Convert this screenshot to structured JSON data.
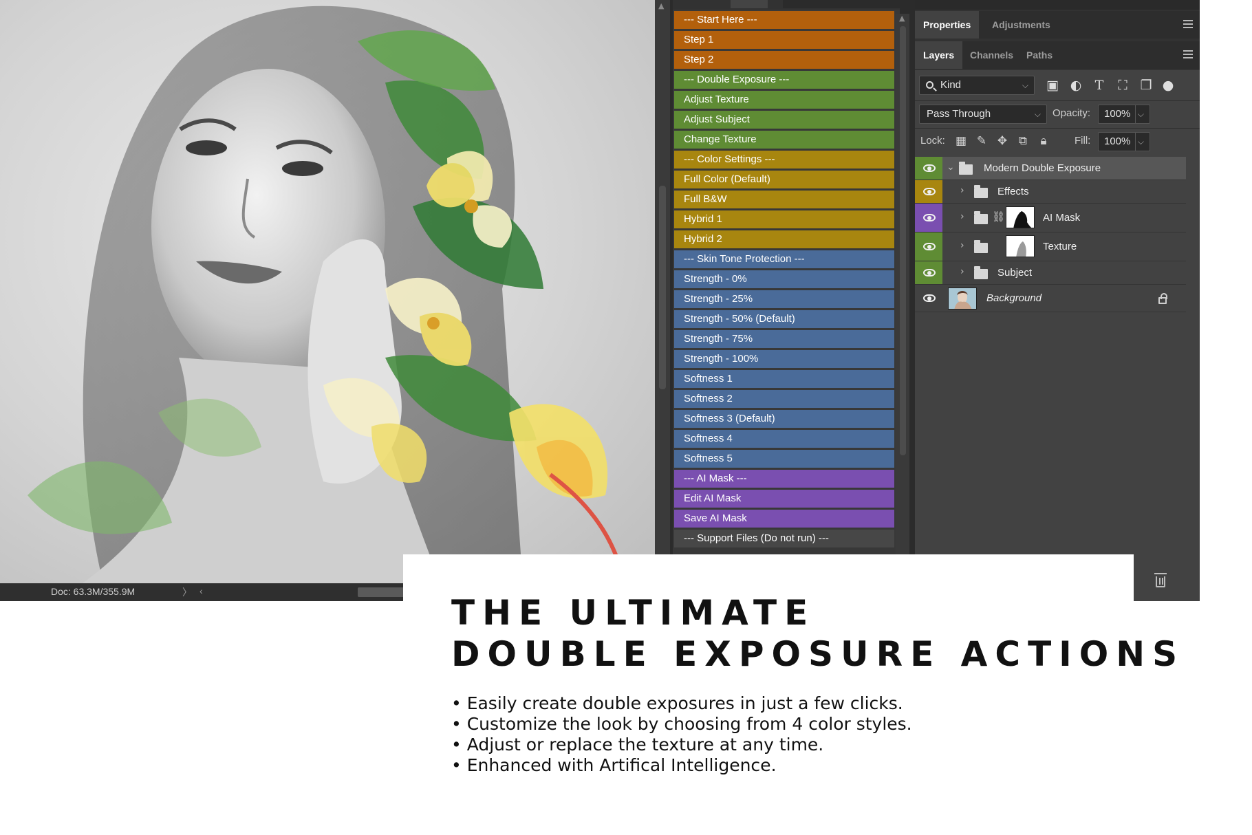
{
  "status_bar": {
    "doc_info": "Doc: 63.3M/355.9M",
    "arrow_right": "〉",
    "arrow_left": "‹"
  },
  "actions": {
    "items": [
      {
        "label": "--- Start Here ---",
        "color": "#b3600c"
      },
      {
        "label": "Step 1",
        "color": "#b3600c"
      },
      {
        "label": "Step 2",
        "color": "#b3600c"
      },
      {
        "label": "--- Double Exposure ---",
        "color": "#5f8c34"
      },
      {
        "label": "Adjust Texture",
        "color": "#5f8c34"
      },
      {
        "label": "Adjust Subject",
        "color": "#5f8c34"
      },
      {
        "label": "Change Texture",
        "color": "#5f8c34"
      },
      {
        "label": "--- Color Settings ---",
        "color": "#a8860f"
      },
      {
        "label": "Full Color (Default)",
        "color": "#a8860f"
      },
      {
        "label": "Full B&W",
        "color": "#a8860f"
      },
      {
        "label": "Hybrid 1",
        "color": "#a8860f"
      },
      {
        "label": "Hybrid 2",
        "color": "#a8860f"
      },
      {
        "label": "--- Skin Tone Protection ---",
        "color": "#4a6b99"
      },
      {
        "label": "Strength - 0%",
        "color": "#4a6b99"
      },
      {
        "label": "Strength - 25%",
        "color": "#4a6b99"
      },
      {
        "label": "Strength - 50% (Default)",
        "color": "#4a6b99"
      },
      {
        "label": "Strength - 75%",
        "color": "#4a6b99"
      },
      {
        "label": "Strength - 100%",
        "color": "#4a6b99"
      },
      {
        "label": "Softness 1",
        "color": "#4a6b99"
      },
      {
        "label": "Softness 2",
        "color": "#4a6b99"
      },
      {
        "label": "Softness 3 (Default)",
        "color": "#4a6b99"
      },
      {
        "label": "Softness 4",
        "color": "#4a6b99"
      },
      {
        "label": "Softness 5",
        "color": "#4a6b99"
      },
      {
        "label": "--- AI Mask ---",
        "color": "#7a4fb0"
      },
      {
        "label": "Edit AI Mask",
        "color": "#7a4fb0"
      },
      {
        "label": "Save AI Mask",
        "color": "#7a4fb0"
      },
      {
        "label": "--- Support Files (Do not run) ---",
        "color": "#474747"
      }
    ]
  },
  "properties_tabs": {
    "properties": "Properties",
    "adjustments": "Adjustments"
  },
  "layers_tabs": {
    "layers": "Layers",
    "channels": "Channels",
    "paths": "Paths"
  },
  "layers_panel": {
    "kind": "Kind",
    "blend_mode": "Pass Through",
    "opacity_label": "Opacity:",
    "opacity_value": "100%",
    "lock_label": "Lock:",
    "fill_label": "Fill:",
    "fill_value": "100%",
    "filter_icons": [
      "image-filter-icon",
      "adjustment-filter-icon",
      "type-filter-icon",
      "shape-filter-icon",
      "smart-object-filter-icon",
      "filter-toggle-icon"
    ],
    "layers": [
      {
        "name": "Modern Double Exposure",
        "eye_color": "#5f8c34",
        "type": "group-open"
      },
      {
        "name": "Effects",
        "eye_color": "#a8860f",
        "type": "group"
      },
      {
        "name": "AI Mask",
        "eye_color": "#7a4fb0",
        "type": "group-mask"
      },
      {
        "name": "Texture",
        "eye_color": "#5f8c34",
        "type": "group-mask"
      },
      {
        "name": "Subject",
        "eye_color": "#5f8c34",
        "type": "group"
      },
      {
        "name": "Background",
        "eye_color": "#424242",
        "type": "background"
      }
    ]
  },
  "marketing": {
    "headline_line1": "THE ULTIMATE",
    "headline_line2": "DOUBLE EXPOSURE ACTIONS",
    "bullets": [
      "• Easily create double exposures in just a few clicks.",
      "• Customize the look by choosing from 4 color styles.",
      "• Adjust or replace the texture at any time.",
      "• Enhanced with Artifical Intelligence."
    ]
  }
}
